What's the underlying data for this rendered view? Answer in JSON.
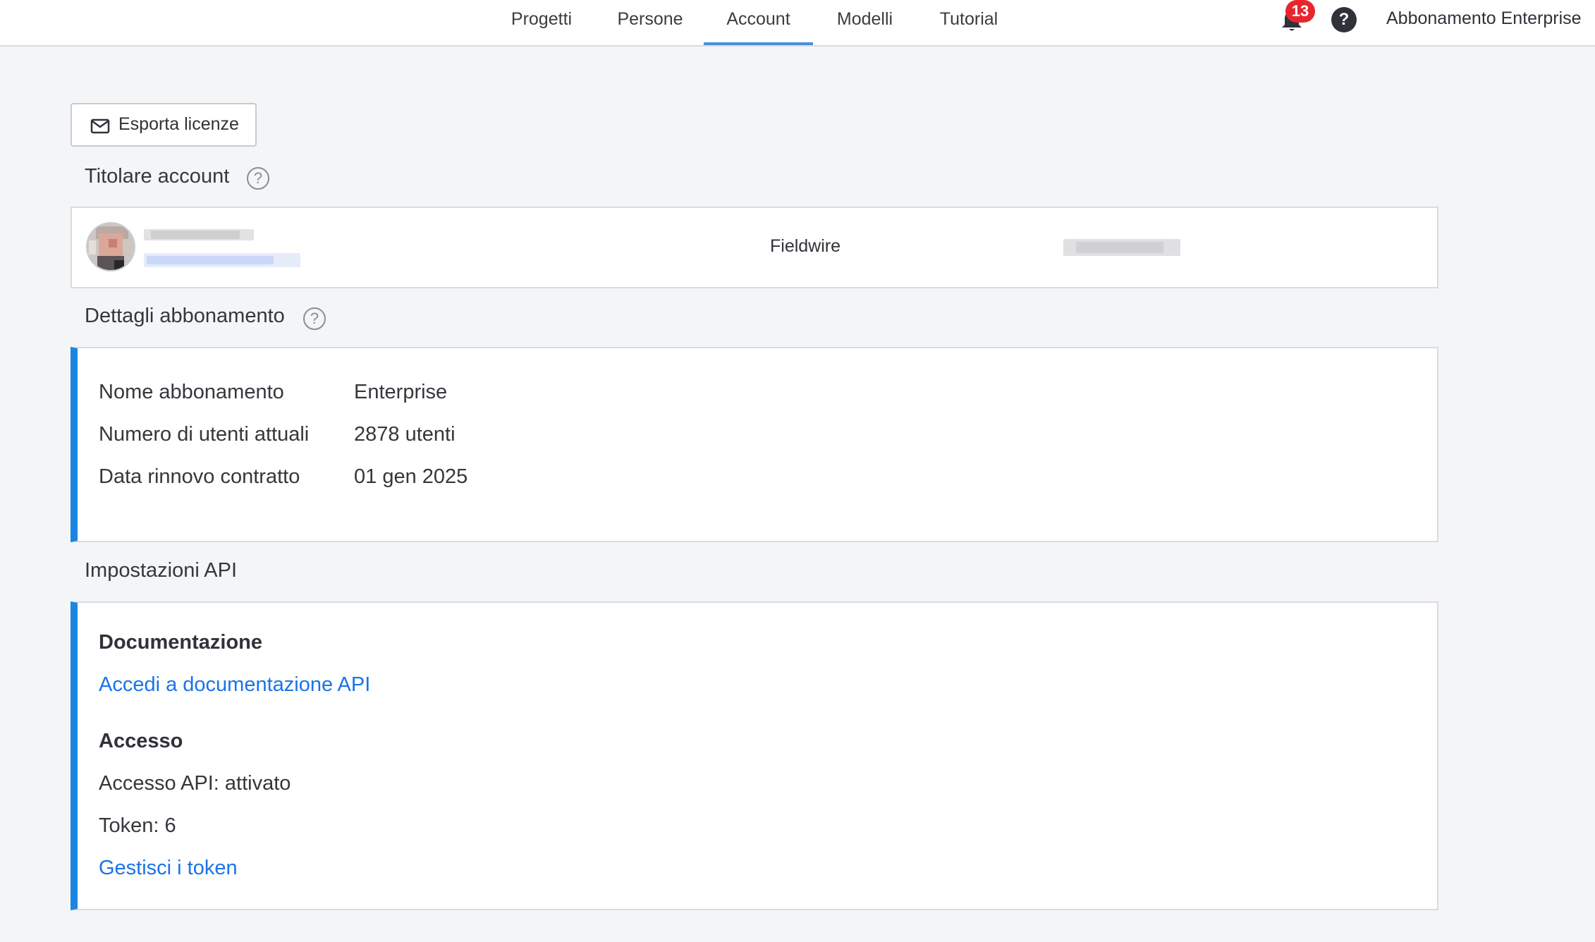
{
  "nav": {
    "tabs": [
      {
        "label": "Progetti"
      },
      {
        "label": "Persone"
      },
      {
        "label": "Account",
        "active": true
      },
      {
        "label": "Modelli"
      },
      {
        "label": "Tutorial"
      }
    ],
    "notifications_count": "13",
    "help_symbol": "?",
    "plan_label": "Abbonamento Enterprise"
  },
  "toolbar": {
    "export_label": "Esporta licenze",
    "export_icon": "mail-icon"
  },
  "owner": {
    "section_title": "Titolare account",
    "help_symbol": "?",
    "company": "Fieldwire"
  },
  "subscription": {
    "section_title": "Dettagli abbonamento",
    "help_symbol": "?",
    "rows": [
      {
        "label": "Nome abbonamento",
        "value": "Enterprise"
      },
      {
        "label": "Numero di utenti attuali",
        "value": "2878 utenti"
      },
      {
        "label": "Data rinnovo contratto",
        "value": "01 gen 2025"
      }
    ]
  },
  "api": {
    "section_title": "Impostazioni API",
    "documentation_heading": "Documentazione",
    "documentation_link": "Accedi a documentazione API",
    "access_heading": "Accesso",
    "access_status": "Accesso API: attivato",
    "tokens": "Token: 6",
    "manage_tokens_link": "Gestisci i token"
  },
  "colors": {
    "accent": "#1a86e0",
    "link": "#1a73e8",
    "badge": "#e8252f",
    "active_tab_underline": "#4a90d9"
  }
}
